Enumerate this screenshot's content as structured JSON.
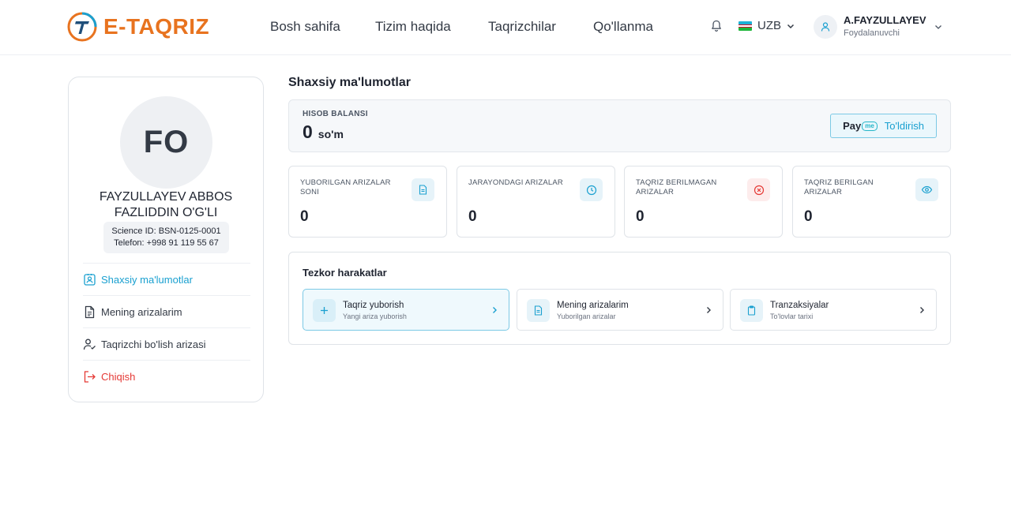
{
  "brand": {
    "name": "E-TAQRIZ",
    "color": "#e8731f",
    "accent": "#1aa0d0"
  },
  "nav": {
    "items": [
      "Bosh sahifa",
      "Tizim haqida",
      "Taqrizchilar",
      "Qo'llanma"
    ]
  },
  "header": {
    "lang": "UZB",
    "user": {
      "name": "A.FAYZULLAYEV",
      "role": "Foydalanuvchi"
    }
  },
  "profile": {
    "initials": "FO",
    "name_line1": "FAYZULLAYEV ABBOS",
    "name_line2": "FAZLIDDIN O'G'LI",
    "science_id": "Science ID: BSN-0125-0001",
    "phone": "Telefon: +998 91 119 55 67",
    "menu": [
      {
        "label": "Shaxsiy ma'lumotlar",
        "icon": "user-badge-icon"
      },
      {
        "label": "Mening arizalarim",
        "icon": "document-icon"
      },
      {
        "label": "Taqrizchi bo'lish arizasi",
        "icon": "user-check-icon"
      },
      {
        "label": "Chiqish",
        "icon": "logout-icon"
      }
    ]
  },
  "main": {
    "title": "Shaxsiy ma'lumotlar",
    "balance": {
      "label": "HISOB BALANSI",
      "value": "0",
      "currency": "so'm",
      "provider": "Pay",
      "provider_suffix": "me",
      "topup_label": "To'ldirish"
    },
    "stats": [
      {
        "label": "YUBORILGAN ARIZALAR SONI",
        "value": "0",
        "icon": "document-icon",
        "color": "#1aa0d0"
      },
      {
        "label": "JARAYONDAGI ARIZALAR",
        "value": "0",
        "icon": "clock-icon",
        "color": "#1aa0d0"
      },
      {
        "label": "TAQRIZ BERILMAGAN ARIZALAR",
        "value": "0",
        "icon": "cancel-circle-icon",
        "color": "#e53935"
      },
      {
        "label": "TAQRIZ BERILGAN ARIZALAR",
        "value": "0",
        "icon": "eye-icon",
        "color": "#1aa0d0"
      }
    ],
    "quick": {
      "title": "Tezkor harakatlar",
      "actions": [
        {
          "title": "Taqriz yuborish",
          "subtitle": "Yangi ariza yuborish",
          "icon": "plus-icon"
        },
        {
          "title": "Mening arizalarim",
          "subtitle": "Yuborilgan arizalar",
          "icon": "document-icon"
        },
        {
          "title": "Tranzaksiyalar",
          "subtitle": "To'lovlar tarixi",
          "icon": "clipboard-icon"
        }
      ]
    }
  }
}
